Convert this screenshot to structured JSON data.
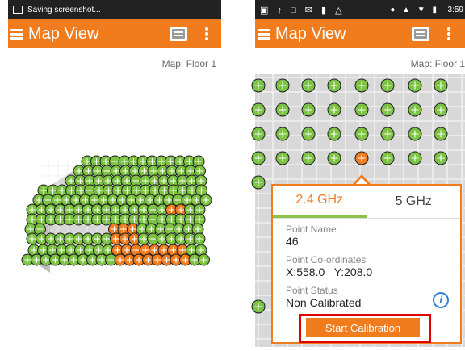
{
  "left_screen": {
    "status_text": "Saving screenshot...",
    "app_title": "Map View",
    "map_label": "Map: Floor 1"
  },
  "right_screen": {
    "status_time": "3:59",
    "app_title": "Map View",
    "map_label": "Map: Floor 1",
    "popup": {
      "tabs": [
        "2.4 GHz",
        "5 GHz"
      ],
      "active_tab": "2.4 GHz",
      "point_name_label": "Point Name",
      "point_name": "46",
      "coords_label": "Point Co-ordinates",
      "x_coord": "X:558.0",
      "y_coord": "Y:208.0",
      "status_label": "Point Status",
      "status_value": "Non Calibrated",
      "calibrate_label": "Start Calibration"
    }
  },
  "colors": {
    "accent": "#f07c1e",
    "calibrated": "#7cc243",
    "uncalibrated": "#f07c1e",
    "highlight": "#e00000",
    "info": "#2f7fd6"
  }
}
